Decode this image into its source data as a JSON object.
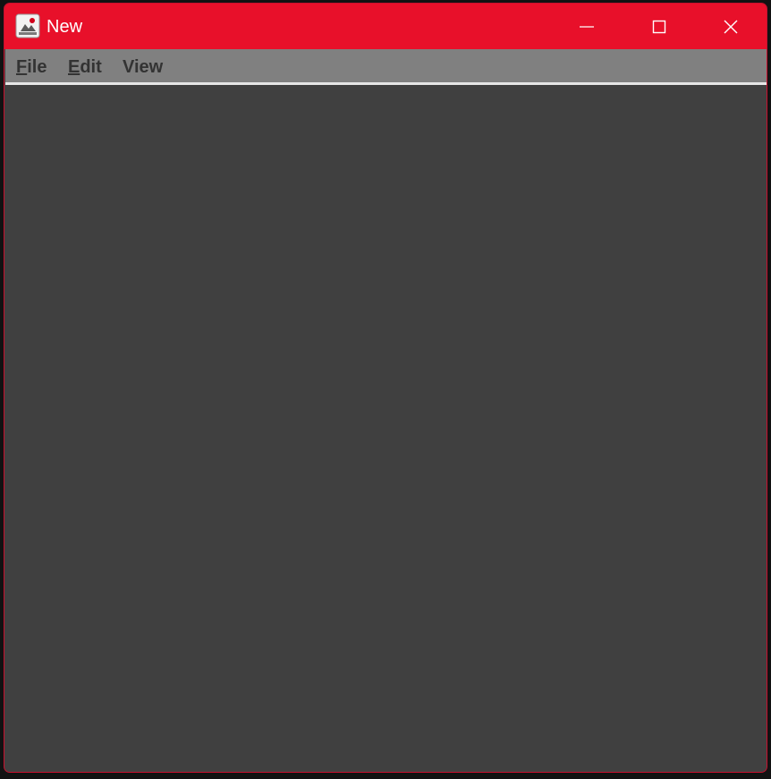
{
  "window": {
    "title": "New",
    "accent_color": "#e8102a",
    "icon": "java-app-icon",
    "controls": {
      "minimize_icon": "minimize-icon",
      "maximize_icon": "maximize-icon",
      "close_icon": "close-icon"
    }
  },
  "menubar": {
    "background": "#808080",
    "items": [
      {
        "mnemonic": "F",
        "rest": "ile"
      },
      {
        "mnemonic": "E",
        "rest": "dit"
      },
      {
        "mnemonic": "",
        "rest": "View"
      }
    ]
  },
  "content": {
    "background": "#404040"
  }
}
